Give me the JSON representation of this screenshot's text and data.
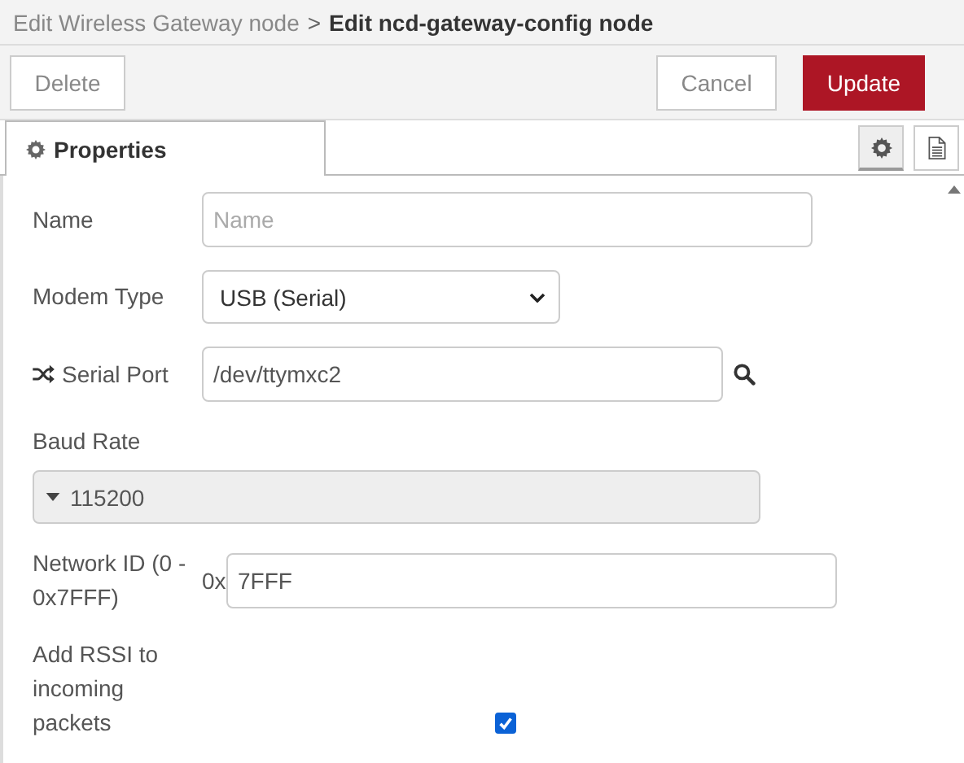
{
  "breadcrumb": {
    "parent": "Edit Wireless Gateway node",
    "separator": ">",
    "current": "Edit ncd-gateway-config node"
  },
  "buttons": [
    {
      "label": "Delete",
      "kind": "plain"
    },
    {
      "label": "Cancel",
      "kind": "plain"
    },
    {
      "label": "Update",
      "kind": "primary"
    }
  ],
  "tabs": [
    {
      "label": "Properties",
      "selected": true
    }
  ],
  "side_tabs": [
    {
      "kind": "settings",
      "selected": true
    },
    {
      "kind": "info",
      "selected": false
    }
  ],
  "fields": [
    {
      "kind": "text",
      "label": "Name",
      "placeholder": "Name"
    },
    {
      "kind": "select",
      "label": "Modem Type",
      "value": "USB (Serial)"
    },
    {
      "kind": "port",
      "label": "Serial Port",
      "value": "/dev/ttymxc2"
    },
    {
      "kind": "stacked",
      "label": "Baud Rate",
      "value": "115200"
    },
    {
      "kind": "prefixed",
      "label": "Network ID (0 - 0x7FFF)",
      "prefix": "0x",
      "value": "7FFF"
    },
    {
      "kind": "checkbox",
      "label": "Add RSSI to incoming packets",
      "checked": true
    }
  ]
}
